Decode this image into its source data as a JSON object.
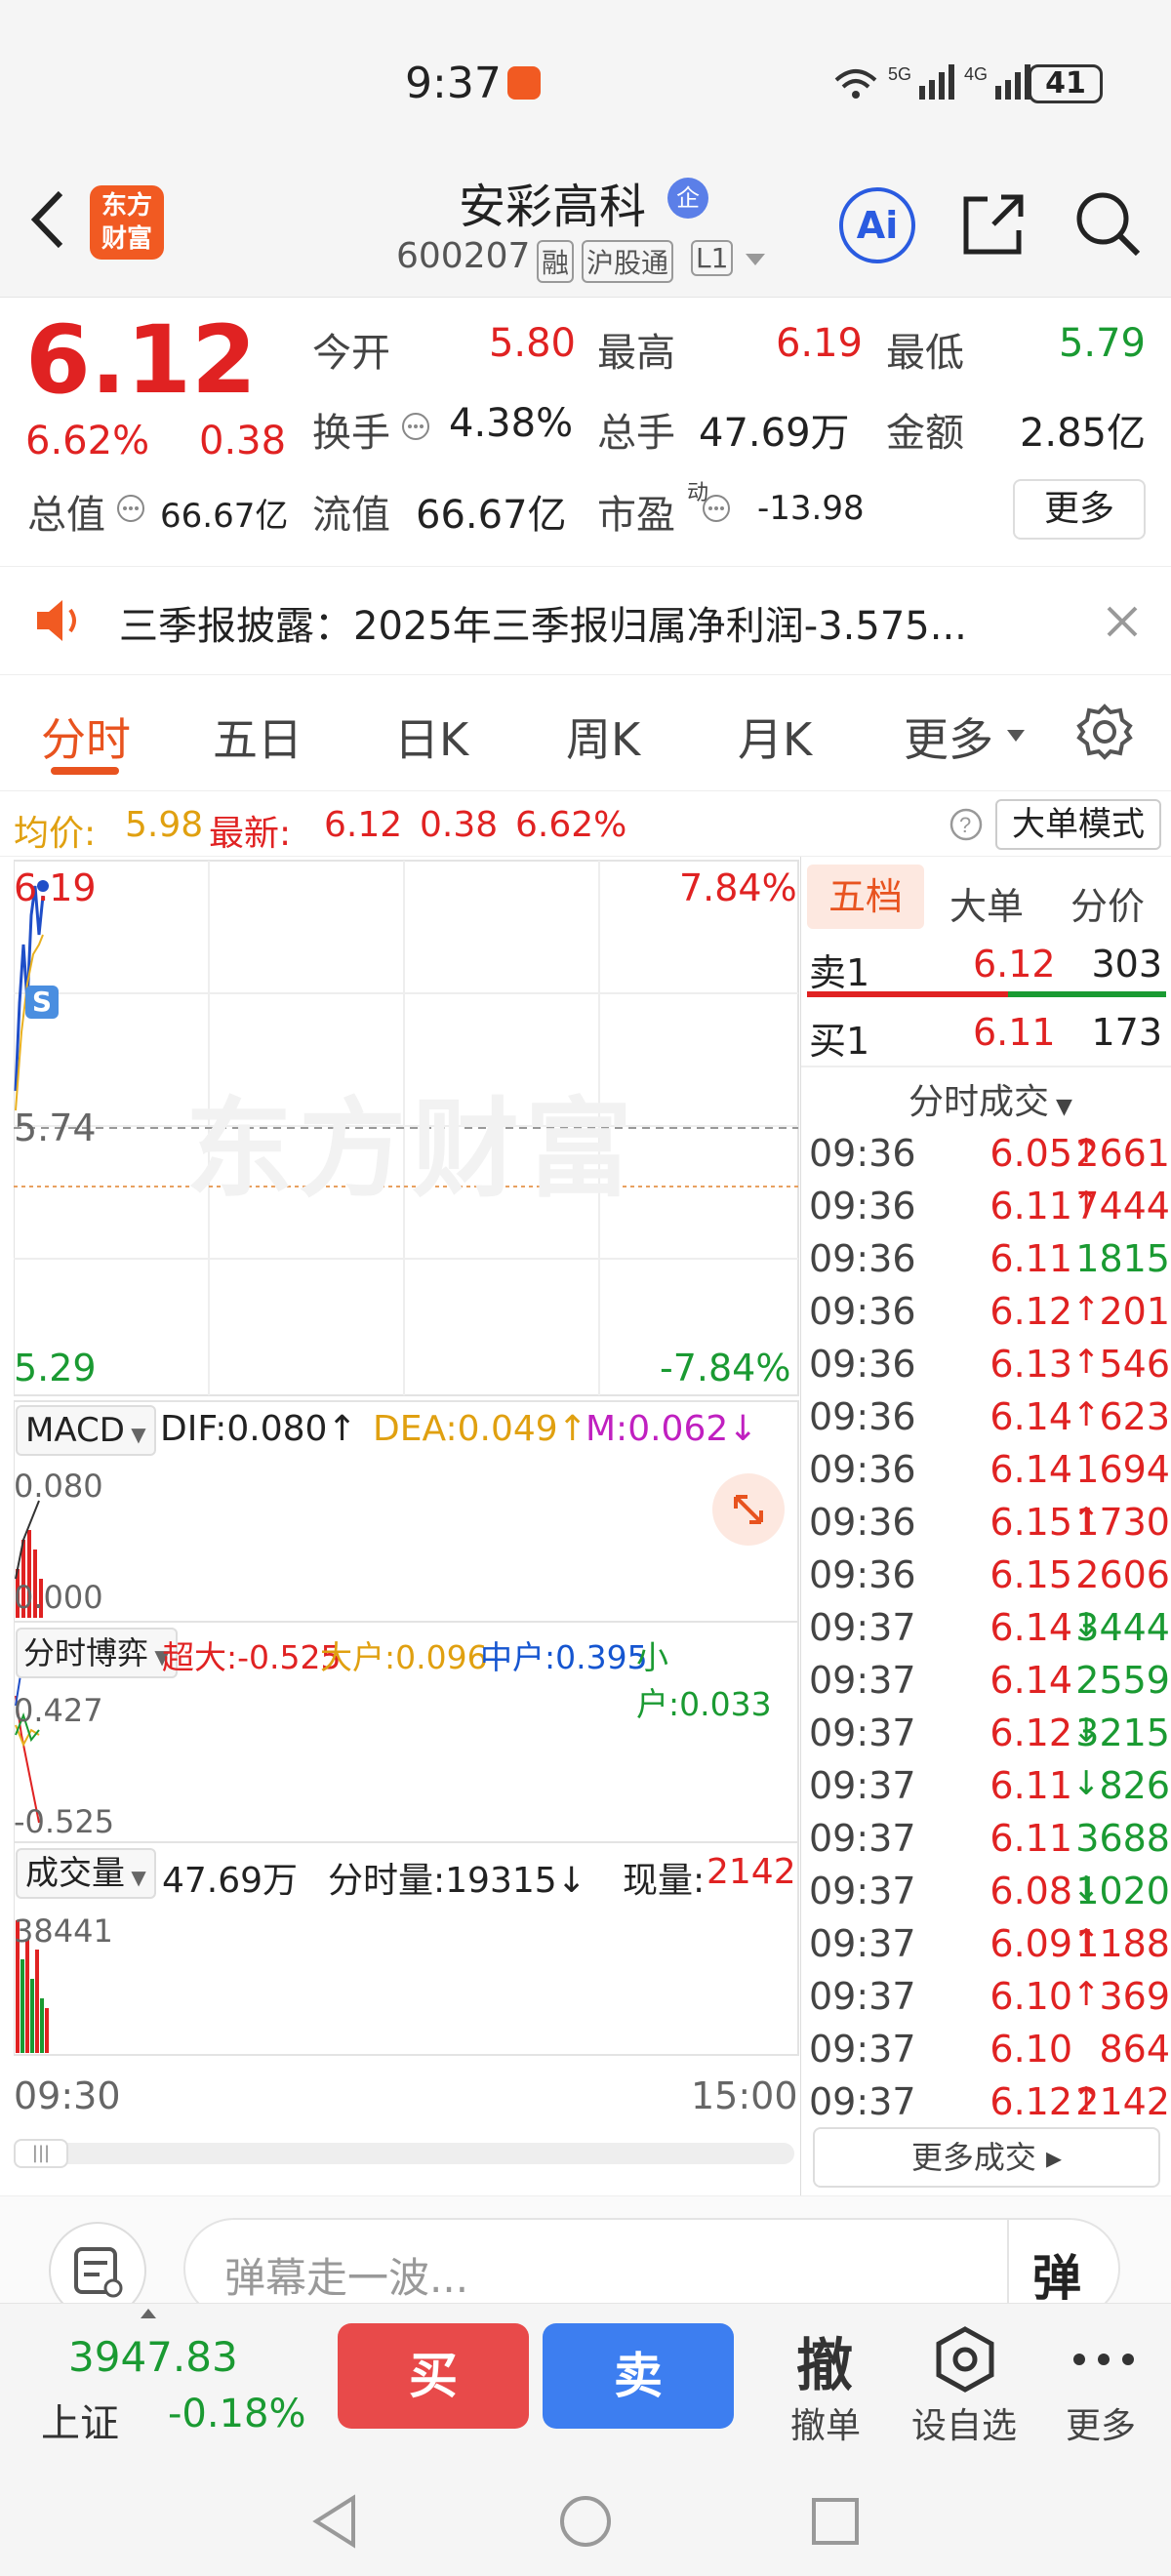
{
  "status": {
    "time": "9:37",
    "battery": "41",
    "net1": "6",
    "net2": "5G",
    "net3": "4G"
  },
  "header": {
    "logo": "东方财富",
    "stock_name": "安彩高科",
    "badge": "企",
    "code": "600207",
    "tag1": "融",
    "tag2": "沪股通",
    "tag3": "L1",
    "ai_label": "Ai"
  },
  "quote": {
    "price": "6.12",
    "pct": "6.62%",
    "change": "0.38",
    "open_label": "今开",
    "open": "5.80",
    "high_label": "最高",
    "high": "6.19",
    "low_label": "最低",
    "low": "5.79",
    "turnover_label": "换手",
    "turnover": "4.38%",
    "volume_label": "总手",
    "volume": "47.69万",
    "amount_label": "金额",
    "amount": "2.85亿",
    "mcap_label": "总值",
    "mcap": "66.67亿",
    "float_label": "流值",
    "float": "66.67亿",
    "pe_label": "市盈",
    "pe_sup": "动",
    "pe": "-13.98",
    "more_label": "更多"
  },
  "notice": {
    "text": "三季报披露：2025年三季报归属净利润-3.575..."
  },
  "tabs": {
    "items": [
      "分时",
      "五日",
      "日K",
      "周K",
      "月K",
      "更多"
    ],
    "active": 0
  },
  "avgline": {
    "avg_label": "均价:",
    "avg": "5.98",
    "latest_label": "最新:",
    "latest": "6.12",
    "change": "0.38",
    "pct": "6.62%",
    "mode_button": "大单模式"
  },
  "chart": {
    "price_top": "6.19",
    "price_mid": "5.74",
    "price_bot": "5.29",
    "pct_top": "7.84%",
    "pct_bot": "-7.84%",
    "watermark": "东方财富",
    "s_marker": "S",
    "macd": {
      "selector": "MACD",
      "dif": "DIF:0.080↑",
      "dea": "DEA:0.049↑",
      "m": "M:0.062↓",
      "top": "0.080",
      "bot": "0.000"
    },
    "game": {
      "selector": "分时博弈",
      "chaoda": "超大:-0.525",
      "dahu": "大户:0.096",
      "zhonghu": "中户:0.395",
      "xiaohu": "小户:0.033",
      "top": "0.427",
      "bot": "-0.525"
    },
    "volume": {
      "selector": "成交量",
      "total": "47.69万",
      "tick_label": "分时量:19315↓",
      "now_label": "现量:",
      "now": "2142",
      "top": "38441"
    },
    "time_start": "09:30",
    "time_end": "15:00"
  },
  "orderbook": {
    "tabs": [
      "五档",
      "大单",
      "分价"
    ],
    "sell_label": "卖1",
    "sell_price": "6.12",
    "sell_vol": "303",
    "buy_label": "买1",
    "buy_price": "6.11",
    "buy_vol": "173",
    "ticks_title": "分时成交",
    "ticks": [
      {
        "t": "09:36",
        "p": "6.05",
        "a": "↑",
        "v": "2661",
        "c": "red"
      },
      {
        "t": "09:36",
        "p": "6.11",
        "a": "↑",
        "v": "7444",
        "c": "red"
      },
      {
        "t": "09:36",
        "p": "6.11",
        "a": "",
        "v": "1815",
        "c": "green"
      },
      {
        "t": "09:36",
        "p": "6.12",
        "a": "↑",
        "v": "201",
        "c": "red"
      },
      {
        "t": "09:36",
        "p": "6.13",
        "a": "↑",
        "v": "546",
        "c": "red"
      },
      {
        "t": "09:36",
        "p": "6.14",
        "a": "↑",
        "v": "623",
        "c": "red"
      },
      {
        "t": "09:36",
        "p": "6.14",
        "a": "",
        "v": "1694",
        "c": "red"
      },
      {
        "t": "09:36",
        "p": "6.15",
        "a": "↑",
        "v": "1730",
        "c": "red"
      },
      {
        "t": "09:36",
        "p": "6.15",
        "a": "",
        "v": "2606",
        "c": "red"
      },
      {
        "t": "09:37",
        "p": "6.14",
        "a": "↓",
        "v": "3444",
        "c": "green"
      },
      {
        "t": "09:37",
        "p": "6.14",
        "a": "",
        "v": "2559",
        "c": "green"
      },
      {
        "t": "09:37",
        "p": "6.12",
        "a": "↓",
        "v": "3215",
        "c": "green"
      },
      {
        "t": "09:37",
        "p": "6.11",
        "a": "↓",
        "v": "826",
        "c": "green"
      },
      {
        "t": "09:37",
        "p": "6.11",
        "a": "",
        "v": "3688",
        "c": "green"
      },
      {
        "t": "09:37",
        "p": "6.08",
        "a": "↓",
        "v": "1020",
        "c": "green"
      },
      {
        "t": "09:37",
        "p": "6.09",
        "a": "↑",
        "v": "1188",
        "c": "red"
      },
      {
        "t": "09:37",
        "p": "6.10",
        "a": "↑",
        "v": "369",
        "c": "red"
      },
      {
        "t": "09:37",
        "p": "6.10",
        "a": "",
        "v": "864",
        "c": "red"
      },
      {
        "t": "09:37",
        "p": "6.12",
        "a": "↑",
        "v": "2142",
        "c": "red"
      }
    ],
    "more_ticks": "更多成交 ▸"
  },
  "danmu": {
    "placeholder": "弹幕走一波...",
    "button": "弹"
  },
  "bottom": {
    "index_value": "3947.83",
    "index_name": "上证",
    "index_pct": "-0.18%",
    "buy": "买",
    "sell": "卖",
    "cancel_icon": "撤",
    "cancel": "撤单",
    "watch": "设自选",
    "more": "更多"
  },
  "colors": {
    "up": "#e02222",
    "down": "#1a9a32",
    "accent": "#e8531f",
    "buy_btn": "#e84a4a",
    "sell_btn": "#3d7ef0"
  }
}
